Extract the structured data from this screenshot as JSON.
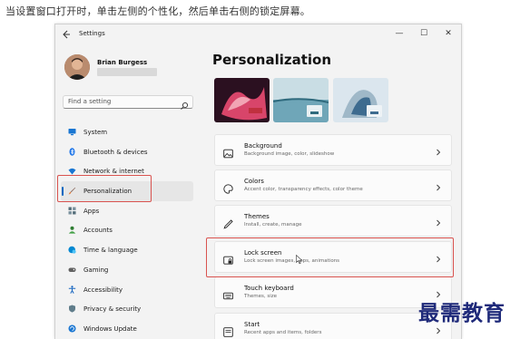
{
  "instruction": "当设置窗口打开时，单击左侧的个性化，然后单击右侧的锁定屏幕。",
  "window": {
    "title": "Settings",
    "controls": [
      "—",
      "☐",
      "✕"
    ]
  },
  "profile": {
    "name": "Brian Burgess"
  },
  "search": {
    "placeholder": "Find a setting"
  },
  "sidebar": {
    "items": [
      {
        "label": "System",
        "icon": "monitor-icon",
        "color": "#1976d2"
      },
      {
        "label": "Bluetooth & devices",
        "icon": "bluetooth-icon",
        "color": "#1a73e8"
      },
      {
        "label": "Network & internet",
        "icon": "wifi-icon",
        "color": "#1976d2"
      },
      {
        "label": "Personalization",
        "icon": "brush-icon",
        "color": "#e07b39",
        "active": true
      },
      {
        "label": "Apps",
        "icon": "apps-icon",
        "color": "#546e7a"
      },
      {
        "label": "Accounts",
        "icon": "person-icon",
        "color": "#2e7d32"
      },
      {
        "label": "Time & language",
        "icon": "globe-clock-icon",
        "color": "#0288d1"
      },
      {
        "label": "Gaming",
        "icon": "gamepad-icon",
        "color": "#616161"
      },
      {
        "label": "Accessibility",
        "icon": "accessibility-icon",
        "color": "#1565c0"
      },
      {
        "label": "Privacy & security",
        "icon": "shield-icon",
        "color": "#607d8b"
      },
      {
        "label": "Windows Update",
        "icon": "update-icon",
        "color": "#1976d2"
      }
    ]
  },
  "main": {
    "title": "Personalization",
    "themes": [
      {
        "name": "theme-glow",
        "colors": [
          "#2b1020",
          "#d8456a",
          "#f2a4b4"
        ]
      },
      {
        "name": "theme-flow",
        "colors": [
          "#6fa6b8",
          "#c9dde4",
          "#2f6a7d"
        ]
      },
      {
        "name": "theme-bloom",
        "colors": [
          "#9fb8c8",
          "#dbe6ee",
          "#3d6b8f"
        ]
      }
    ],
    "cards": [
      {
        "title": "Background",
        "desc": "Background image, color, slideshow",
        "icon": "image-icon"
      },
      {
        "title": "Colors",
        "desc": "Accent color, transparency effects, color theme",
        "icon": "palette-icon"
      },
      {
        "title": "Themes",
        "desc": "Install, create, manage",
        "icon": "pen-icon"
      },
      {
        "title": "Lock screen",
        "desc": "Lock screen images, apps, animations",
        "icon": "lock-screen-icon"
      },
      {
        "title": "Touch keyboard",
        "desc": "Themes, size",
        "icon": "keyboard-icon"
      },
      {
        "title": "Start",
        "desc": "Recent apps and items, folders",
        "icon": "start-icon"
      }
    ]
  },
  "watermark": "最需教育",
  "highlight_color": "#d9534f"
}
